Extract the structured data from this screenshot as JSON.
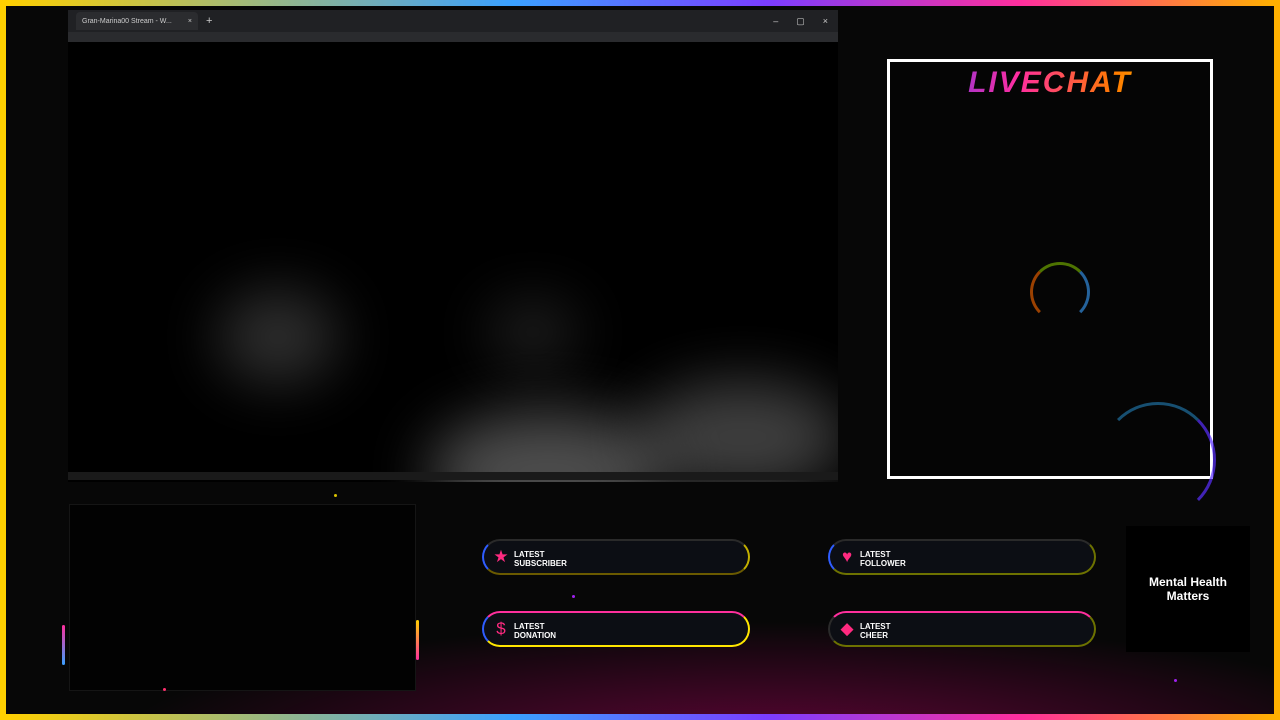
{
  "browser": {
    "tab_title": "Gran-Marina00 Stream - W...",
    "tab_close": "×",
    "new_tab": "+",
    "controls": [
      "–",
      "▢",
      "×"
    ]
  },
  "chat": {
    "title": "LIVECHAT"
  },
  "alerts": [
    {
      "line1": "LATEST",
      "line2": "SUBSCRIBER",
      "icon": "★"
    },
    {
      "line1": "LATEST",
      "line2": "FOLLOWER",
      "icon": "♥"
    },
    {
      "line1": "LATEST",
      "line2": "DONATION",
      "icon": "$"
    },
    {
      "line1": "LATEST",
      "line2": "CHEER",
      "icon": "◆"
    }
  ],
  "side_panel": {
    "text": "Mental Health Matters"
  }
}
